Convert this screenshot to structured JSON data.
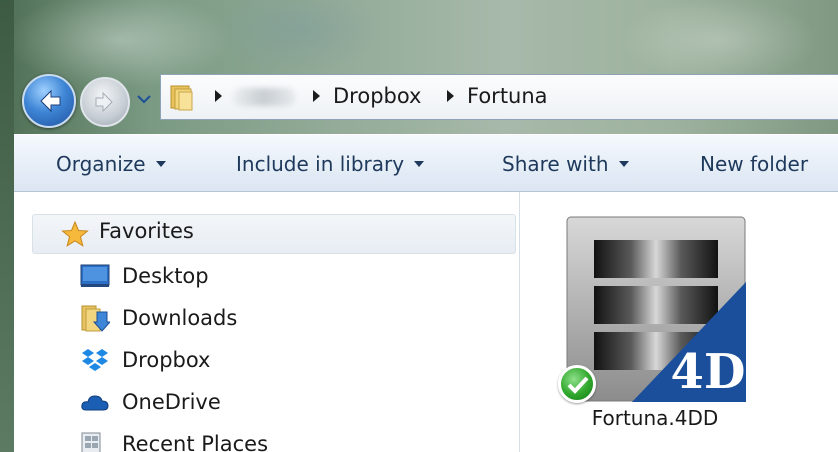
{
  "address_bar": {
    "crumbs": [
      "Dropbox",
      "Fortuna"
    ]
  },
  "command_bar": {
    "organize": "Organize",
    "include_in_library": "Include in library",
    "share_with": "Share with",
    "new_folder": "New folder"
  },
  "nav_pane": {
    "favorites_label": "Favorites",
    "items": [
      {
        "label": "Desktop",
        "icon": "desktop-icon"
      },
      {
        "label": "Downloads",
        "icon": "downloads-folder-icon"
      },
      {
        "label": "Dropbox",
        "icon": "dropbox-icon"
      },
      {
        "label": "OneDrive",
        "icon": "onedrive-cloud-icon"
      },
      {
        "label": "Recent Places",
        "icon": "recent-places-icon"
      }
    ]
  },
  "files": [
    {
      "name": "Fortuna.4DD",
      "icon": "4d-database-icon",
      "status": "synced",
      "badge_text": "4D"
    }
  ],
  "colors": {
    "command_text": "#1e395b",
    "accent_blue": "#1c4f9b",
    "sync_green": "#2fa72c"
  }
}
